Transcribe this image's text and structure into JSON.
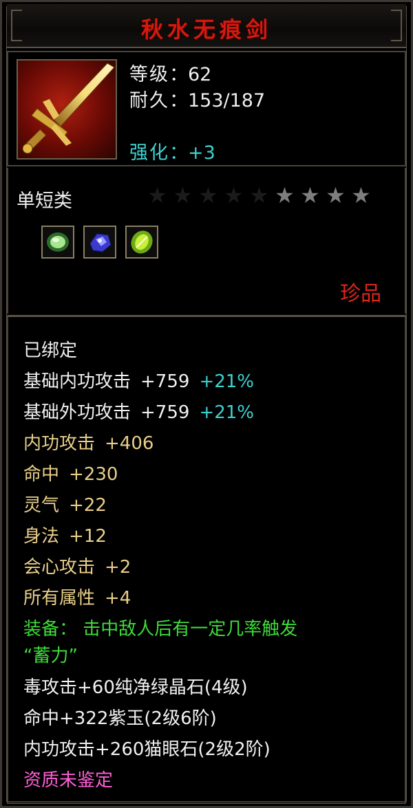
{
  "item": {
    "name": "秋水无痕剑",
    "level_label": "等级",
    "level_value": "62",
    "durability_label": "耐久",
    "durability_value": "153/187",
    "enhance_label": "强化",
    "enhance_value": "+3",
    "category": "单短类",
    "stars": {
      "total": 9,
      "lit": 4
    },
    "rarity": "珍品",
    "gems": [
      "green-jade-gem",
      "purple-gem",
      "cats-eye-gem"
    ]
  },
  "colors": {
    "title": "#d4190f",
    "base_attr": "#f2f2f2",
    "bonus": "#3fd1d1",
    "extra_attr": "#e9cf8a",
    "set_effect": "#3fdb3a",
    "unidentified": "#ff5fd6"
  },
  "attributes": {
    "bound": "已绑定",
    "base_inner": {
      "label": "基础内功攻击",
      "value": "+759",
      "bonus": "+21%"
    },
    "base_outer": {
      "label": "基础外功攻击",
      "value": "+759",
      "bonus": "+21%"
    },
    "extras": [
      {
        "label": "内功攻击",
        "value": "+406"
      },
      {
        "label": "命中",
        "value": "+230"
      },
      {
        "label": "灵气",
        "value": "+22"
      },
      {
        "label": "身法",
        "value": "+12"
      },
      {
        "label": "会心攻击",
        "value": "+2"
      },
      {
        "label": "所有属性",
        "value": "+4"
      }
    ],
    "equip_effect_line1": "装备：  击中敌人后有一定几率触发",
    "equip_effect_line2": "“蓄力”",
    "gem_lines": [
      "毒攻击+60纯净绿晶石(4级)",
      "命中+322紫玉(2级6阶)",
      "内功攻击+260猫眼石(2级2阶)"
    ],
    "quality": "资质未鉴定"
  }
}
